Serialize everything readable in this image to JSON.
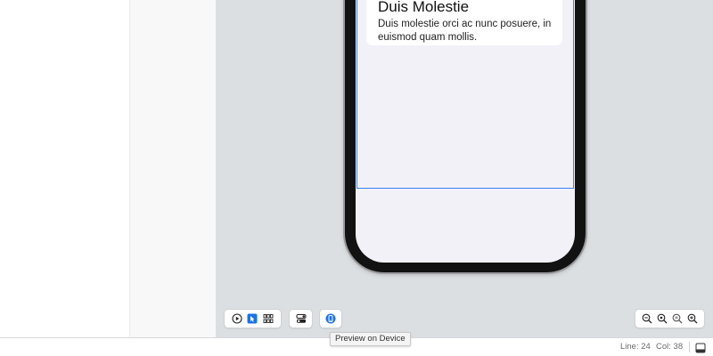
{
  "preview": {
    "card": {
      "title": "Duis Molestie",
      "body": "Duis molestie orci ac nunc posuere, in euismod quam mollis."
    }
  },
  "toolbar": {
    "left_group": [
      {
        "icon": "play-icon"
      },
      {
        "icon": "select-cursor-icon"
      },
      {
        "icon": "grid-icon"
      }
    ],
    "variants_icon": "device-settings-icon",
    "device_icon": "preview-on-device-icon",
    "zoom_group": [
      {
        "icon": "zoom-out-icon"
      },
      {
        "icon": "zoom-to-fit-icon"
      },
      {
        "icon": "zoom-actual-icon"
      },
      {
        "icon": "zoom-in-icon"
      }
    ]
  },
  "tooltip": {
    "text": "Preview on Device"
  },
  "status": {
    "line_label": "Line: 24",
    "col_label": "Col: 38",
    "panel_icon": "panel-toggle-icon"
  },
  "colors": {
    "accent": "#1a73e8",
    "canvas_bg": "#dcdfe2",
    "selection": "#3b82f6"
  }
}
